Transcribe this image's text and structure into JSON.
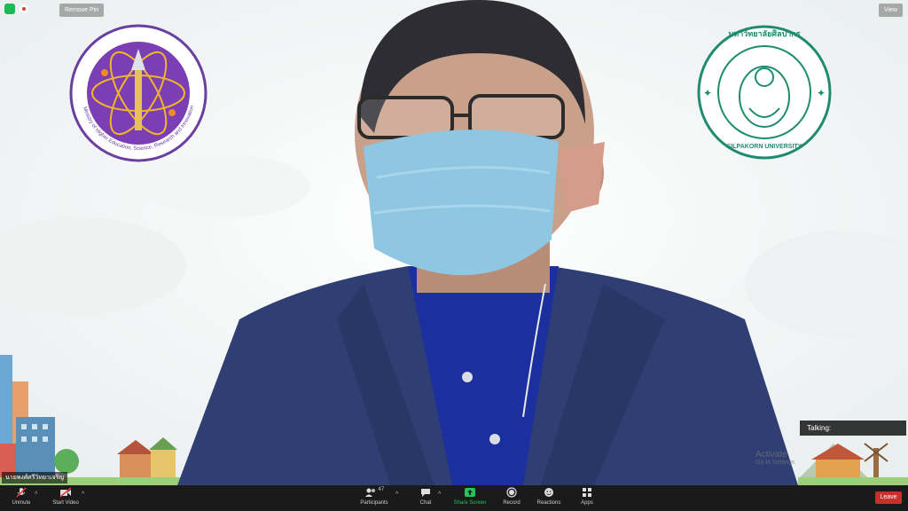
{
  "top_bar": {
    "remove_pin_label": "Remove Pin",
    "view_label": "View"
  },
  "participant": {
    "name": "นายพงศ์ศรีวิทยาเจริญ"
  },
  "speaker_box": {
    "label": "Talking:"
  },
  "watermark": {
    "line1": "Activate",
    "line2": "Go to Settings"
  },
  "logos": {
    "left": {
      "text": "Ministry of Higher Education, Science, Research and Innovation"
    },
    "right": {
      "text_top": "มหาวิทยาลัยศิลปากร",
      "text_bottom": "SILPAKORN UNIVERSITY"
    }
  },
  "toolbar": {
    "unmute_label": "Unmute",
    "start_video_label": "Start Video",
    "participants_label": "Participants",
    "participants_count": "47",
    "chat_label": "Chat",
    "share_screen_label": "Share Screen",
    "record_label": "Record",
    "reactions_label": "Reactions",
    "apps_label": "Apps",
    "leave_label": "Leave"
  },
  "colors": {
    "share_green": "#22c55e",
    "leave_red": "#c9302c",
    "toolbar_bg": "#1a1a1a"
  }
}
